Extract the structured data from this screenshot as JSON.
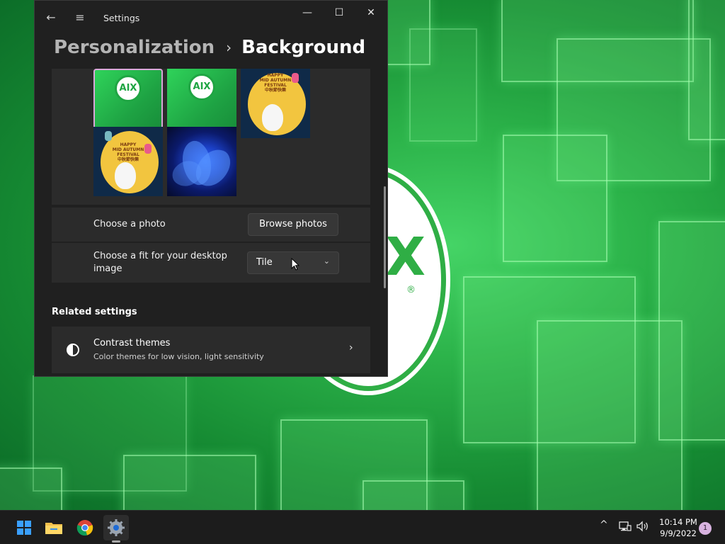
{
  "window": {
    "title": "Settings",
    "back_icon": "←",
    "menu_icon": "≡",
    "minimize_icon": "—",
    "maximize_icon": "☐",
    "close_icon": "✕"
  },
  "breadcrumb": {
    "parent": "Personalization",
    "separator": "›",
    "current": "Background"
  },
  "thumbnails": [
    {
      "kind": "aix",
      "label": "AIX",
      "selected": true
    },
    {
      "kind": "aix",
      "label": "AIX",
      "selected": false
    },
    {
      "kind": "moon",
      "line1": "HAPPY",
      "line2": "MID AUTUMN",
      "line3": "FESTIVAL",
      "line4": "中秋節快樂",
      "selected": false
    },
    {
      "kind": "moon",
      "line1": "HAPPY",
      "line2": "MID AUTUMN",
      "line3": "FESTIVAL",
      "line4": "中秋節快樂",
      "selected": false
    },
    {
      "kind": "bloom",
      "selected": false
    }
  ],
  "choose_photo": {
    "label": "Choose a photo",
    "button": "Browse photos"
  },
  "choose_fit": {
    "label_line1": "Choose a fit for your desktop",
    "label_line2": "image",
    "value": "Tile",
    "chevron": "⌄"
  },
  "related": {
    "heading": "Related settings",
    "contrast_title": "Contrast themes",
    "contrast_subtitle": "Color themes for low vision, light sensitivity",
    "chevron": "›"
  },
  "wallpaper": {
    "logo_letter": "X",
    "logo_reg": "®"
  },
  "taskbar": {
    "tray_up": "^",
    "time": "10:14 PM",
    "date": "9/9/2022",
    "notification_count": "1"
  },
  "colors": {
    "accent": "#3aa0ff",
    "window_bg": "#202020",
    "card_bg": "#2b2b2b",
    "wallpaper_green": "#2cb34a"
  }
}
